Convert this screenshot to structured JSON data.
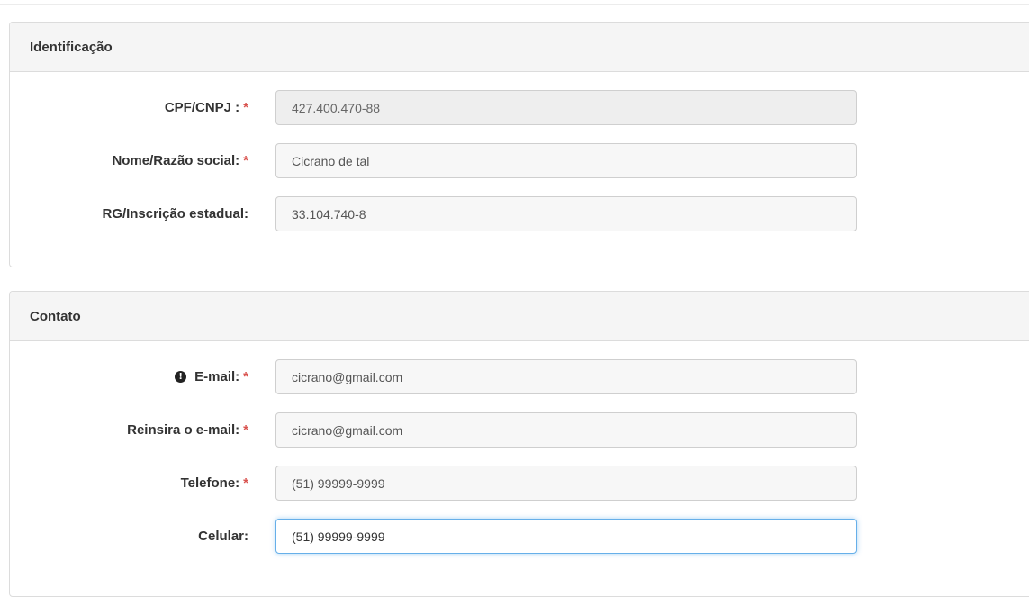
{
  "sections": {
    "identificacao": {
      "title": "Identificação",
      "fields": {
        "cpf": {
          "label": "CPF/CNPJ :",
          "required": "*",
          "value": "427.400.470-88"
        },
        "nome": {
          "label": "Nome/Razão social:",
          "required": "*",
          "value": "Cicrano de tal"
        },
        "rg": {
          "label": "RG/Inscrição estadual:",
          "value": "33.104.740-8"
        }
      }
    },
    "contato": {
      "title": "Contato",
      "fields": {
        "email": {
          "icon": "exclamation-circle-icon",
          "icon_glyph": "!",
          "label": "E-mail:",
          "required": "*",
          "value": "cicrano@gmail.com"
        },
        "email_confirm": {
          "label": "Reinsira o e-mail:",
          "required": "*",
          "value": "cicrano@gmail.com"
        },
        "telefone": {
          "label": "Telefone:",
          "required": "*",
          "value": "(51) 99999-9999"
        },
        "celular": {
          "label": "Celular:",
          "value": "(51) 99999-9999"
        }
      }
    }
  },
  "colors": {
    "required_marker": "#d9534f",
    "focus_border": "#66afe9",
    "panel_heading_bg": "#f5f5f5"
  }
}
